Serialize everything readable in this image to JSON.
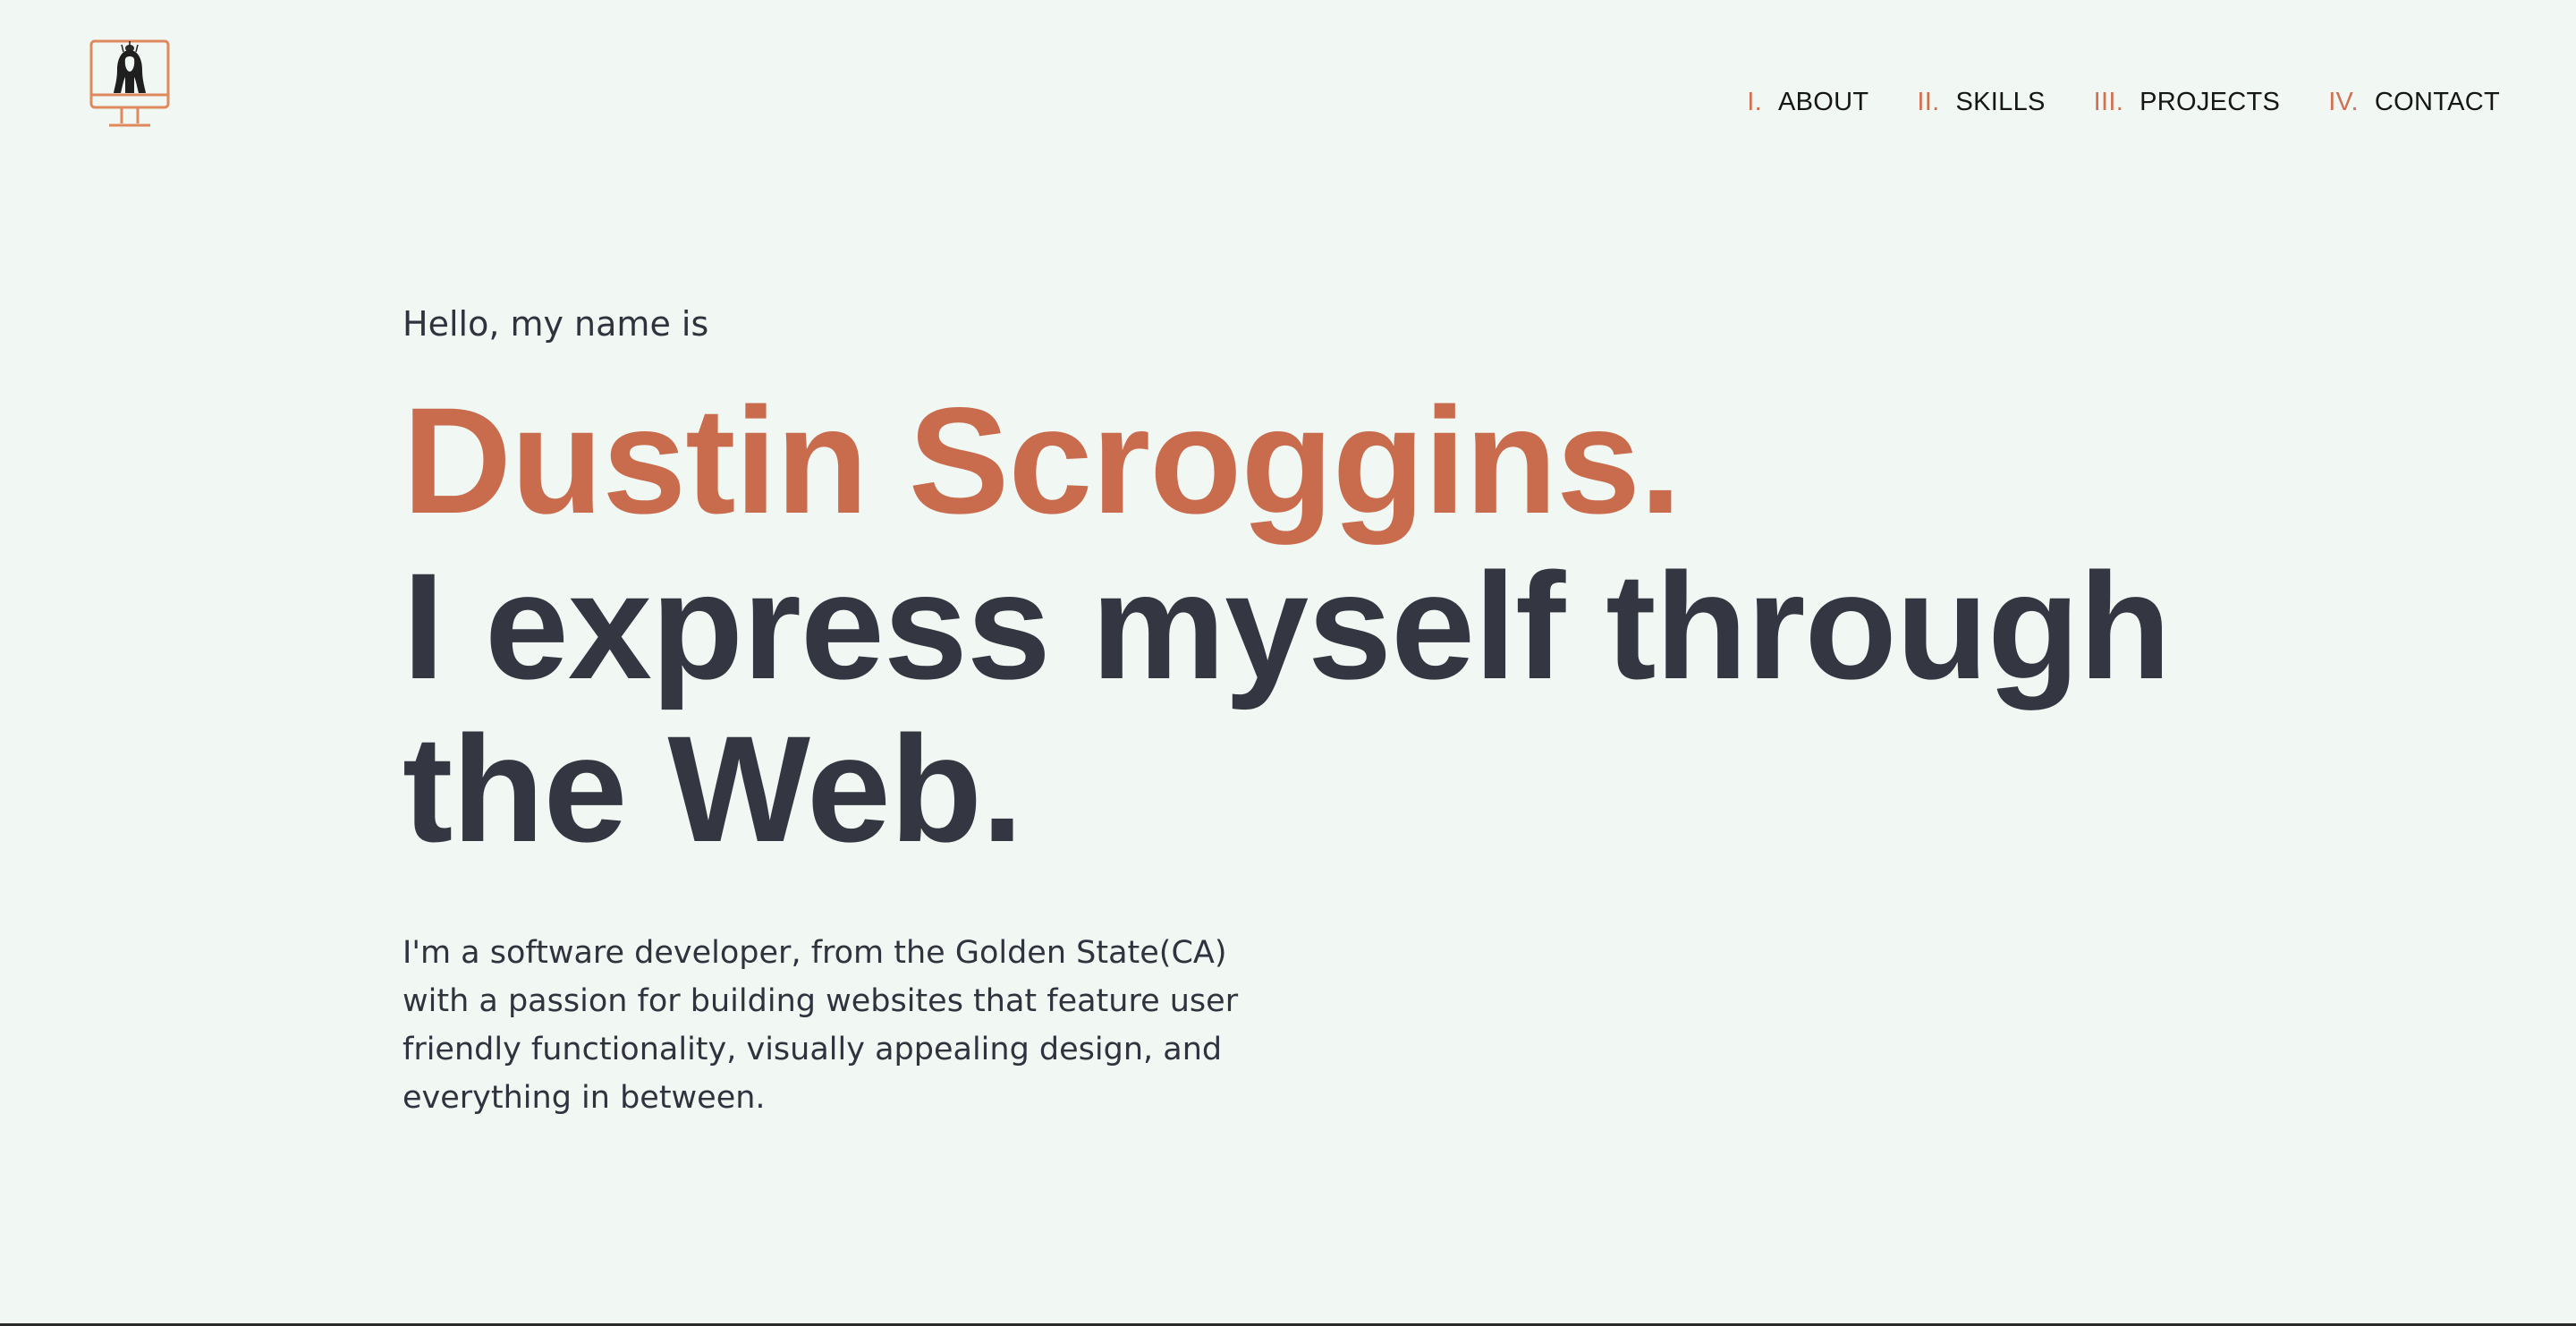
{
  "nav": {
    "items": [
      {
        "num": "I.",
        "label": "ABOUT"
      },
      {
        "num": "II.",
        "label": "SKILLS"
      },
      {
        "num": "III.",
        "label": "PROJECTS"
      },
      {
        "num": "IV.",
        "label": "CONTACT"
      }
    ]
  },
  "hero": {
    "greeting": "Hello, my name is",
    "name": "Dustin Scroggins.",
    "tagline": "I express myself through the Web.",
    "bio": "I'm a software developer, from the Golden State(CA) with a passion for building websites that feature user friendly functionality, visually appealing design, and everything in between."
  },
  "logo": {
    "icon": "monitor-portrait-icon"
  },
  "colors": {
    "accent": "#c96c4d",
    "nav_number": "#d07050",
    "text_dark": "#343641",
    "background": "#f1f7f2"
  }
}
